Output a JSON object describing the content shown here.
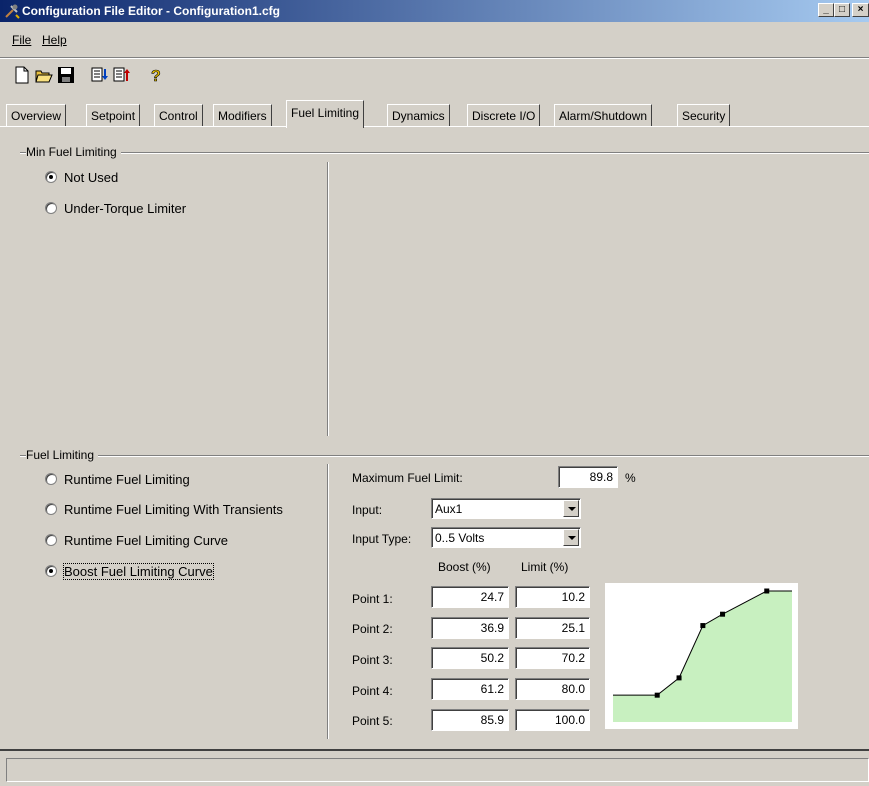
{
  "window": {
    "title": "Configuration File Editor - Configuration1.cfg",
    "controls": [
      "_",
      "□",
      "×"
    ]
  },
  "menu": {
    "file": "File",
    "help": "Help"
  },
  "toolbar": {
    "icons": [
      "new-file-icon",
      "open-folder-icon",
      "save-icon",
      "import-icon",
      "export-icon",
      "help-icon"
    ]
  },
  "tabs": [
    {
      "label": "Overview"
    },
    {
      "label": "Setpoint"
    },
    {
      "label": "Control"
    },
    {
      "label": "Modifiers"
    },
    {
      "label": "Fuel Limiting"
    },
    {
      "label": "Dynamics"
    },
    {
      "label": "Discrete I/O"
    },
    {
      "label": "Alarm/Shutdown"
    },
    {
      "label": "Security"
    }
  ],
  "active_tab": "Fuel Limiting",
  "min_fuel": {
    "title": "Min Fuel Limiting",
    "options": [
      {
        "label": "Not Used",
        "selected": true
      },
      {
        "label": "Under-Torque Limiter",
        "selected": false
      }
    ]
  },
  "fuel_limiting": {
    "title": "Fuel Limiting",
    "options": [
      {
        "label": "Runtime Fuel Limiting",
        "selected": false
      },
      {
        "label": "Runtime Fuel Limiting With Transients",
        "selected": false
      },
      {
        "label": "Runtime Fuel Limiting Curve",
        "selected": false
      },
      {
        "label": "Boost Fuel Limiting Curve",
        "selected": true
      }
    ],
    "max_label": "Maximum Fuel Limit:",
    "max_value": "89.8",
    "max_unit": "%",
    "input_label": "Input:",
    "input_value": "Aux1",
    "input_type_label": "Input Type:",
    "input_type_value": "0..5 Volts",
    "col_boost": "Boost (%)",
    "col_limit": "Limit (%)",
    "points": [
      {
        "label": "Point 1:",
        "boost": "24.7",
        "limit": "10.2"
      },
      {
        "label": "Point 2:",
        "boost": "36.9",
        "limit": "25.1"
      },
      {
        "label": "Point 3:",
        "boost": "50.2",
        "limit": "70.2"
      },
      {
        "label": "Point 4:",
        "boost": "61.2",
        "limit": "80.0"
      },
      {
        "label": "Point 5:",
        "boost": "85.9",
        "limit": "100.0"
      }
    ]
  },
  "chart_data": {
    "type": "area",
    "x": [
      24.7,
      36.9,
      50.2,
      61.2,
      85.9
    ],
    "y": [
      10.2,
      25.1,
      70.2,
      80.0,
      100.0
    ],
    "xlim": [
      0,
      100
    ],
    "ylim": [
      0,
      100
    ],
    "grid": false,
    "fill_color": "#c8f0c0",
    "line_color": "#000000"
  }
}
